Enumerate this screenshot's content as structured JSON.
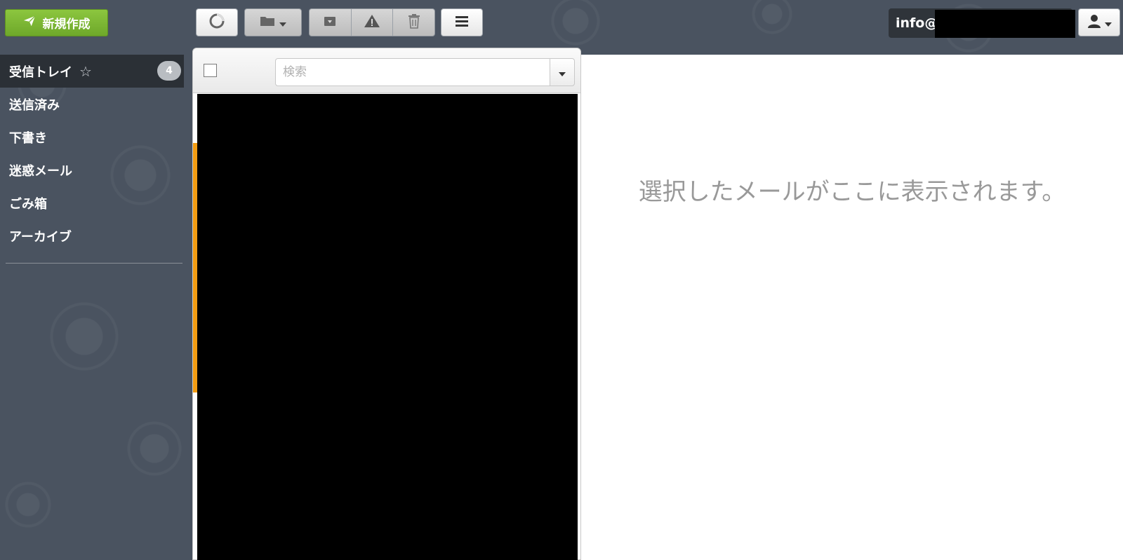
{
  "toolbar": {
    "compose_label": "新規作成",
    "account_email": "info@"
  },
  "sidebar": {
    "items": [
      {
        "label": "受信トレイ",
        "badge": "4",
        "active": true
      },
      {
        "label": "送信済み"
      },
      {
        "label": "下書き"
      },
      {
        "label": "迷惑メール"
      },
      {
        "label": "ごみ箱"
      },
      {
        "label": "アーカイブ"
      }
    ]
  },
  "list": {
    "search_placeholder": "検索"
  },
  "preview": {
    "empty_message": "選択したメールがここに表示されます。"
  },
  "colors": {
    "compose": "#7ab534",
    "accent": "#f39c12",
    "sidebar_bg": "#4a5360",
    "active_bg": "#2b3036"
  }
}
